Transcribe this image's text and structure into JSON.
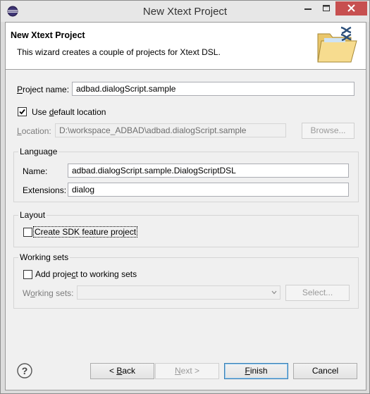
{
  "window": {
    "title": "New Xtext Project",
    "icon": "eclipse-icon",
    "controls": [
      "minimize-icon",
      "maximize-icon",
      "close-icon"
    ],
    "close_color": "#c75050"
  },
  "header": {
    "title": "New Xtext Project",
    "description": "This wizard creates a couple of projects for Xtext DSL.",
    "icon": "xtext-folder-icon"
  },
  "project": {
    "name_label_mnemonic": "P",
    "name_label_rest": "roject name:",
    "name_value": "adbad.dialogScript.sample",
    "use_default_checked": true,
    "use_default_label_prefix": "Use ",
    "use_default_label_mnemonic": "d",
    "use_default_label_rest": "efault location",
    "location_label_mnemonic": "L",
    "location_label_rest": "ocation:",
    "location_value": "D:\\workspace_ADBAD\\adbad.dialogScript.sample",
    "browse_label": "Browse..."
  },
  "language": {
    "group_title": "Language",
    "name_label": "Name:",
    "name_value": "adbad.dialogScript.sample.DialogScriptDSL",
    "extensions_label": "Extensions:",
    "extensions_value": "dialog"
  },
  "layout": {
    "group_title": "Layout",
    "sdk_checked": false,
    "sdk_label": "Create SDK feature project"
  },
  "working_sets": {
    "group_title": "Working sets",
    "add_checked": false,
    "add_label_prefix": "Add proje",
    "add_label_mnemonic": "c",
    "add_label_rest": "t to working sets",
    "sets_label_prefix": "W",
    "sets_label_mnemonic": "o",
    "sets_label_rest": "rking sets:",
    "sets_value": "",
    "select_label": "Select..."
  },
  "buttons": {
    "help_icon": "help-icon",
    "back_prefix": "< ",
    "back_mnemonic": "B",
    "back_rest": "ack",
    "next_mnemonic": "N",
    "next_rest": "ext >",
    "finish_mnemonic": "F",
    "finish_rest": "inish",
    "cancel_label": "Cancel"
  },
  "colors": {
    "header_bg": "#ffffff",
    "dialog_bg": "#f0f0f0",
    "default_button_border": "#3c7fb1"
  }
}
